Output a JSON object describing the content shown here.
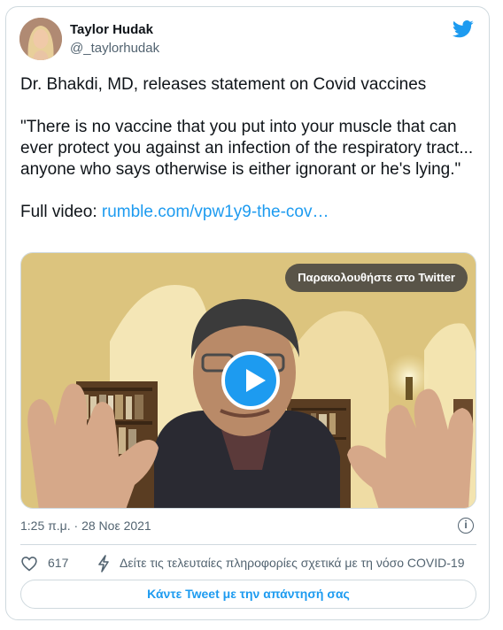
{
  "author": {
    "name": "Taylor Hudak",
    "handle": "@_taylorhudak"
  },
  "icons": {
    "logo": "twitter-bird-icon",
    "like": "heart-icon",
    "info": "info-icon",
    "covid": "bolt-icon",
    "video": "play-icon"
  },
  "tweet": {
    "line1": "Dr. Bhakdi, MD, releases statement on Covid vaccines",
    "quote": "\"There is no vaccine that you put into your muscle that can ever protect you against an infection of the respiratory tract... anyone who says otherwise is either ignorant or he's lying.\"",
    "link_prefix": "Full video:",
    "link_text": "rumble.com/vpw1y9-the-cov…"
  },
  "media": {
    "watch_label": "Παρακολουθήστε στο Twitter"
  },
  "meta": {
    "timestamp": "1:25 π.μ. · 28 Νοε 2021",
    "info_glyph": "i"
  },
  "actions": {
    "likes": "617",
    "covid_text": "Δείτε τις τελευταίες πληροφορίες σχετικά με τη νόσο COVID-19"
  },
  "reply_button": "Κάντε Tweet με την απάντησή σας",
  "colors": {
    "accent": "#1d9bf0",
    "secondary_text": "#536471",
    "border": "#cfd9de"
  }
}
